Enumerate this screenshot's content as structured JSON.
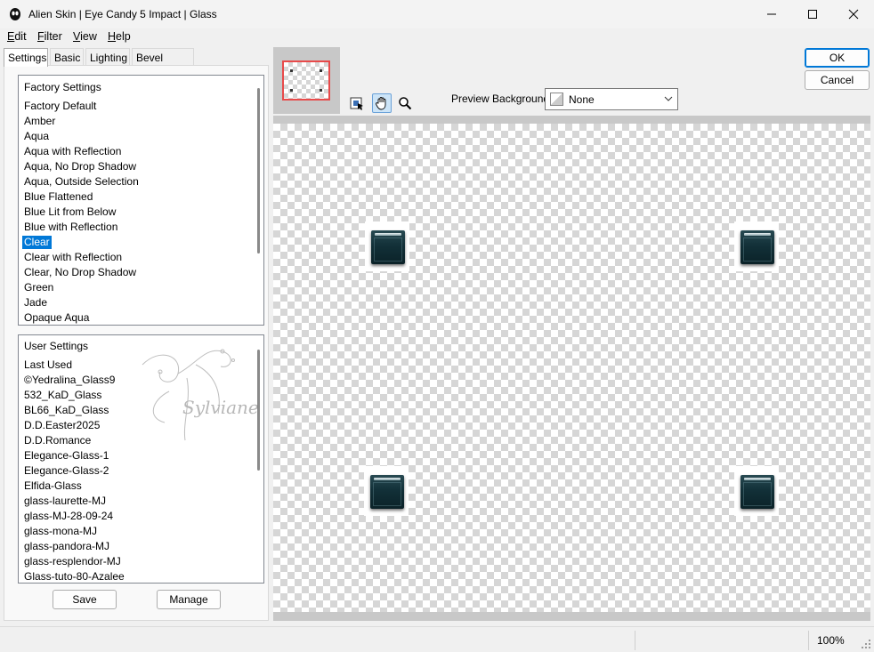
{
  "window": {
    "title": "Alien Skin | Eye Candy 5 Impact | Glass",
    "minimize_icon": "minimize-icon",
    "maximize_icon": "maximize-icon",
    "close_icon": "close-icon"
  },
  "menu": {
    "items": [
      {
        "mnemonic": "E",
        "rest": "dit"
      },
      {
        "mnemonic": "F",
        "rest": "ilter"
      },
      {
        "mnemonic": "V",
        "rest": "iew"
      },
      {
        "mnemonic": "H",
        "rest": "elp"
      }
    ]
  },
  "tabs": [
    "Settings",
    "Basic",
    "Lighting",
    "Bevel Profile"
  ],
  "active_tab": "Settings",
  "factory": {
    "header": "Factory Settings",
    "items": [
      "Factory Default",
      "Amber",
      "Aqua",
      "Aqua with Reflection",
      "Aqua, No Drop Shadow",
      "Aqua, Outside Selection",
      "Blue Flattened",
      "Blue Lit from Below",
      "Blue with Reflection",
      "Clear",
      "Clear with Reflection",
      "Clear, No Drop Shadow",
      "Green",
      "Jade",
      "Opaque Aqua"
    ],
    "selected": "Clear"
  },
  "user": {
    "header": "User Settings",
    "items": [
      "Last Used",
      "©Yedralina_Glass9",
      "532_KaD_Glass",
      "BL66_KaD_Glass",
      "D.D.Easter2025",
      "D.D.Romance",
      "Elegance-Glass-1",
      "Elegance-Glass-2",
      "Elfida-Glass",
      "glass-laurette-MJ",
      "glass-MJ-28-09-24",
      "glass-mona-MJ",
      "glass-pandora-MJ",
      "glass-resplendor-MJ",
      "Glass-tuto-80-Azalee"
    ]
  },
  "watermark_text": "Sylviane",
  "buttons": {
    "save": "Save",
    "manage": "Manage",
    "ok": "OK",
    "cancel": "Cancel"
  },
  "tools": {
    "icons": [
      "navigate-icon",
      "hand-icon",
      "zoom-icon"
    ],
    "active": "hand-icon"
  },
  "preview_background": {
    "label": "Preview Background:",
    "value": "None"
  },
  "status": {
    "zoom": "100%"
  },
  "colors": {
    "selection": "#0078d7",
    "glass": "#123038",
    "thumb_frame": "#e84a4a"
  }
}
